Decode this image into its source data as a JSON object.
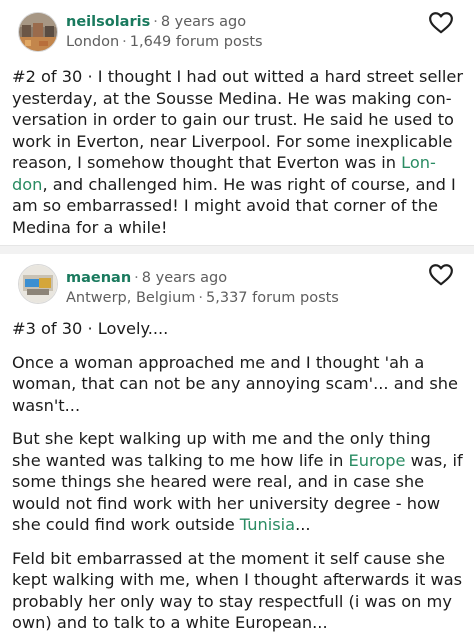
{
  "posts": [
    {
      "username": "neilsolaris",
      "time_ago": "8 years ago",
      "location": "London",
      "forum_posts": "1,649 forum posts",
      "post_number": "#2 of 30",
      "paragraphs": [
        {
          "before": "I thought I had out witted a hard street seller yesterday, at the Sousse Medina. He was making con-versation in order to gain our trust. He said he used to work in Everton, near Liverpool. For some inexplicable reason, I somehow thought that Everton was in ",
          "link": "Lon-don",
          "after": ", and challenged him. He was right of course, and I am so embarrassed! I might avoid that corner of the Medina for a while!"
        }
      ]
    },
    {
      "username": "maenan",
      "time_ago": "8 years ago",
      "location": "Antwerp, Belgium",
      "forum_posts": "5,337 forum posts",
      "post_number": "#3 of 30",
      "first_text": "Lovely....",
      "para1": "Once a woman approached me and I thought 'ah a woman, that can not be any annoying scam'... and she wasn't...",
      "para2": {
        "t1": "But she kept walking up with me and the only thing she wanted was talking to me how life in ",
        "link1": "Europe",
        "t2": " was, if some things she heared were real, and in case she would not find work with her university degree - how she could find work outside ",
        "link2": "Tunisia",
        "t3": "..."
      },
      "para3": "Feld bit embarrassed at the moment it self cause she kept walking with me, when I thought afterwards it was probably her only way to stay respectfull (i was on my own) and to talk to a white European..."
    }
  ],
  "colors": {
    "username": "#1a7a5e",
    "link": "#2a8c63",
    "meta": "#5e5e5e"
  },
  "icons": {
    "like": "heart-outline-icon",
    "separator": "middle-dot"
  }
}
